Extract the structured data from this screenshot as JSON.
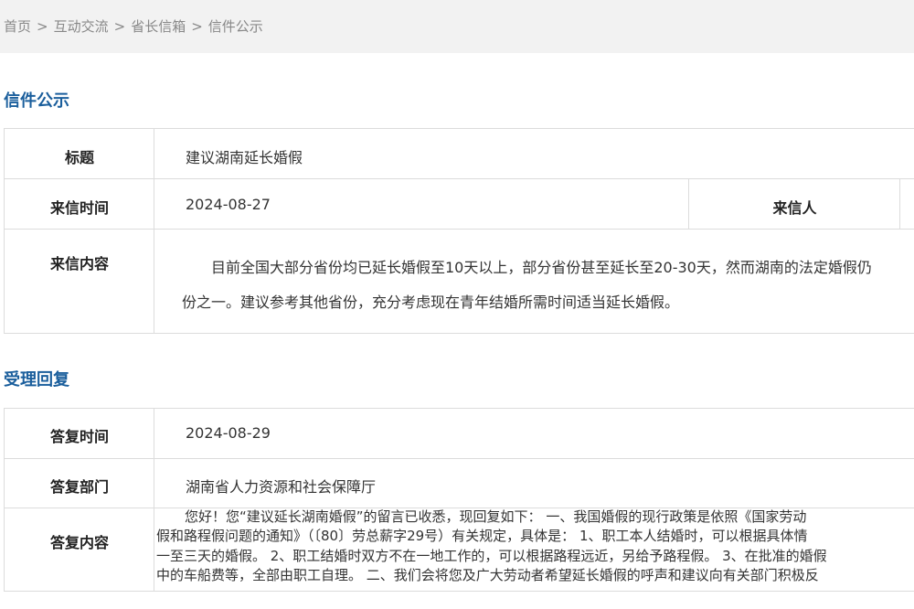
{
  "breadcrumb": {
    "items": [
      "首页",
      "互动交流",
      "省长信箱",
      "信件公示"
    ],
    "separator": ">"
  },
  "letter_section": {
    "title": "信件公示",
    "subject_label": "标题",
    "subject_value": "建议湖南延长婚假",
    "date_label": "来信时间",
    "date_value": "2024-08-27",
    "sender_label": "来信人",
    "content_label": "来信内容",
    "content_lines": [
      "目前全国大部分省份均已延长婚假至10天以上，部分省份甚至延长至20-30天，然而湖南的法定婚假仍",
      "份之一。建议参考其他省份，充分考虑现在青年结婚所需时间适当延长婚假。"
    ]
  },
  "reply_section": {
    "title": "受理回复",
    "date_label": "答复时间",
    "date_value": "2024-08-29",
    "dept_label": "答复部门",
    "dept_value": "湖南省人力资源和社会保障厅",
    "content_label": "答复内容",
    "content_lines": [
      "您好！您“建议延长湖南婚假”的留言已收悉，现回复如下： 一、我国婚假的现行政策是依照《国家劳动",
      "假和路程假问题的通知》（〔80〕劳总薪字29号）有关规定，具体是： 1、职工本人结婚时，可以根据具体情",
      "一至三天的婚假。 2、职工结婚时双方不在一地工作的，可以根据路程远近，另给予路程假。 3、在批准的婚假",
      "中的车船费等，全部由职工自理。 二、我们会将您及广大劳动者希望延长婚假的呼声和建议向有关部门积极反"
    ]
  }
}
